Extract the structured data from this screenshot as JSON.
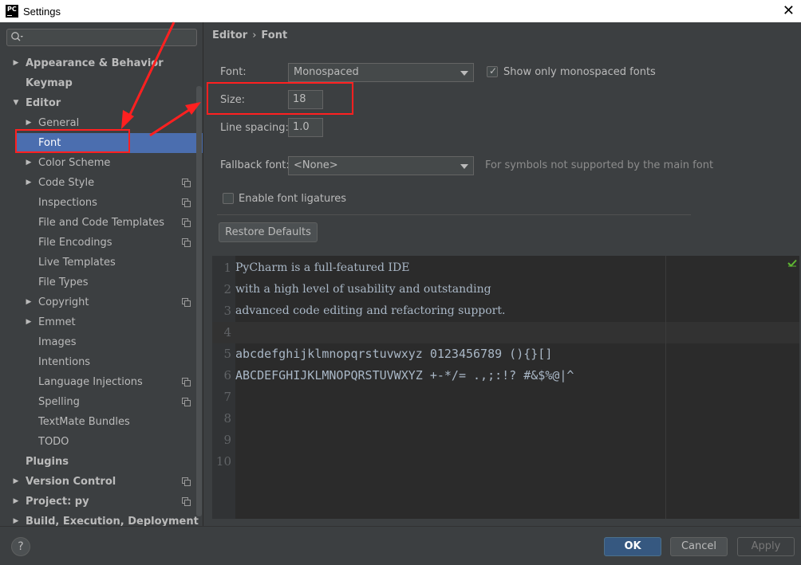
{
  "window": {
    "title": "Settings",
    "app_icon_text": "PC",
    "close_glyph": "✕"
  },
  "search": {
    "placeholder": "",
    "icon": "search-icon"
  },
  "sidebar": {
    "items": [
      {
        "label": "Appearance & Behavior",
        "level": 0,
        "arrow": "▶",
        "bold": true,
        "project_icon": false,
        "selected": false
      },
      {
        "label": "Keymap",
        "level": 0,
        "arrow": "",
        "bold": true,
        "project_icon": false,
        "selected": false
      },
      {
        "label": "Editor",
        "level": 0,
        "arrow": "▼",
        "bold": true,
        "project_icon": false,
        "selected": false
      },
      {
        "label": "General",
        "level": 1,
        "arrow": "▶",
        "bold": false,
        "project_icon": false,
        "selected": false
      },
      {
        "label": "Font",
        "level": 1,
        "arrow": "",
        "bold": false,
        "project_icon": false,
        "selected": true
      },
      {
        "label": "Color Scheme",
        "level": 1,
        "arrow": "▶",
        "bold": false,
        "project_icon": false,
        "selected": false
      },
      {
        "label": "Code Style",
        "level": 1,
        "arrow": "▶",
        "bold": false,
        "project_icon": true,
        "selected": false
      },
      {
        "label": "Inspections",
        "level": 1,
        "arrow": "",
        "bold": false,
        "project_icon": true,
        "selected": false
      },
      {
        "label": "File and Code Templates",
        "level": 1,
        "arrow": "",
        "bold": false,
        "project_icon": true,
        "selected": false
      },
      {
        "label": "File Encodings",
        "level": 1,
        "arrow": "",
        "bold": false,
        "project_icon": true,
        "selected": false
      },
      {
        "label": "Live Templates",
        "level": 1,
        "arrow": "",
        "bold": false,
        "project_icon": false,
        "selected": false
      },
      {
        "label": "File Types",
        "level": 1,
        "arrow": "",
        "bold": false,
        "project_icon": false,
        "selected": false
      },
      {
        "label": "Copyright",
        "level": 1,
        "arrow": "▶",
        "bold": false,
        "project_icon": true,
        "selected": false
      },
      {
        "label": "Emmet",
        "level": 1,
        "arrow": "▶",
        "bold": false,
        "project_icon": false,
        "selected": false
      },
      {
        "label": "Images",
        "level": 1,
        "arrow": "",
        "bold": false,
        "project_icon": false,
        "selected": false
      },
      {
        "label": "Intentions",
        "level": 1,
        "arrow": "",
        "bold": false,
        "project_icon": false,
        "selected": false
      },
      {
        "label": "Language Injections",
        "level": 1,
        "arrow": "",
        "bold": false,
        "project_icon": true,
        "selected": false
      },
      {
        "label": "Spelling",
        "level": 1,
        "arrow": "",
        "bold": false,
        "project_icon": true,
        "selected": false
      },
      {
        "label": "TextMate Bundles",
        "level": 1,
        "arrow": "",
        "bold": false,
        "project_icon": false,
        "selected": false
      },
      {
        "label": "TODO",
        "level": 1,
        "arrow": "",
        "bold": false,
        "project_icon": false,
        "selected": false
      },
      {
        "label": "Plugins",
        "level": 0,
        "arrow": "",
        "bold": true,
        "project_icon": false,
        "selected": false
      },
      {
        "label": "Version Control",
        "level": 0,
        "arrow": "▶",
        "bold": true,
        "project_icon": true,
        "selected": false
      },
      {
        "label": "Project: py",
        "level": 0,
        "arrow": "▶",
        "bold": true,
        "project_icon": true,
        "selected": false
      },
      {
        "label": "Build, Execution, Deployment",
        "level": 0,
        "arrow": "▶",
        "bold": true,
        "project_icon": false,
        "selected": false
      }
    ]
  },
  "breadcrumb": {
    "parent": "Editor",
    "separator": "›",
    "current": "Font"
  },
  "font_settings": {
    "font_label": "Font:",
    "font_value": "Monospaced",
    "monospaced_only_label": "Show only monospaced fonts",
    "monospaced_only_checked": true,
    "size_label": "Size:",
    "size_value": "18",
    "line_spacing_label": "Line spacing:",
    "line_spacing_value": "1.0",
    "fallback_label": "Fallback font:",
    "fallback_value": "<None>",
    "fallback_hint": "For symbols not supported by the main font",
    "ligatures_label": "Enable font ligatures",
    "ligatures_checked": false,
    "restore_label": "Restore Defaults"
  },
  "preview": {
    "lines": [
      {
        "n": "1",
        "text": "PyCharm is a full-featured IDE"
      },
      {
        "n": "2",
        "text": "with a high level of usability and outstanding"
      },
      {
        "n": "3",
        "text": "advanced code editing and refactoring support."
      },
      {
        "n": "4",
        "text": ""
      },
      {
        "n": "5",
        "text": "abcdefghijklmnopqrstuvwxyz 0123456789 (){}[]"
      },
      {
        "n": "6",
        "text": "ABCDEFGHIJKLMNOPQRSTUVWXYZ +-*/= .,;:!? #&$%@|^"
      },
      {
        "n": "7",
        "text": ""
      },
      {
        "n": "8",
        "text": ""
      },
      {
        "n": "9",
        "text": ""
      },
      {
        "n": "10",
        "text": ""
      }
    ],
    "status_icon": "check-icon",
    "status_color": "#5fb832"
  },
  "footer": {
    "help_label": "?",
    "ok_label": "OK",
    "cancel_label": "Cancel",
    "apply_label": "Apply"
  },
  "colors": {
    "selection": "#4b6eaf",
    "annotation": "#ff2020",
    "primary_button": "#365880"
  }
}
